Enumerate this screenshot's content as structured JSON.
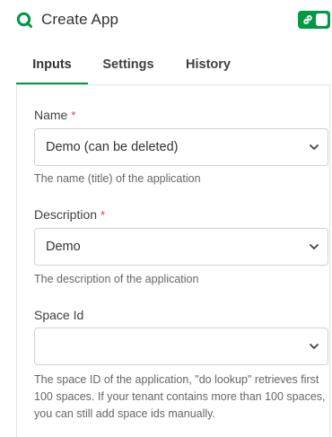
{
  "header": {
    "title": "Create App",
    "logo_icon": "qlik-logo-icon",
    "toggle_icon": "link-icon",
    "toggle_state": "on"
  },
  "tabs": [
    {
      "label": "Inputs",
      "active": true
    },
    {
      "label": "Settings",
      "active": false
    },
    {
      "label": "History",
      "active": false
    }
  ],
  "fields": {
    "name": {
      "label": "Name",
      "required_mark": "*",
      "value": "Demo (can be deleted)",
      "helper": "The name (title) of the application"
    },
    "description": {
      "label": "Description",
      "required_mark": "*",
      "value": "Demo",
      "helper": "The description of the application"
    },
    "space_id": {
      "label": "Space Id",
      "value": "",
      "helper": "The space ID of the application, \"do lookup\" retrieves first 100 spaces. If your tenant contains more than 100 spaces, you can still add space ids manually."
    }
  },
  "colors": {
    "accent": "#009845",
    "required": "#dc423f",
    "border": "#d2d2d2"
  }
}
